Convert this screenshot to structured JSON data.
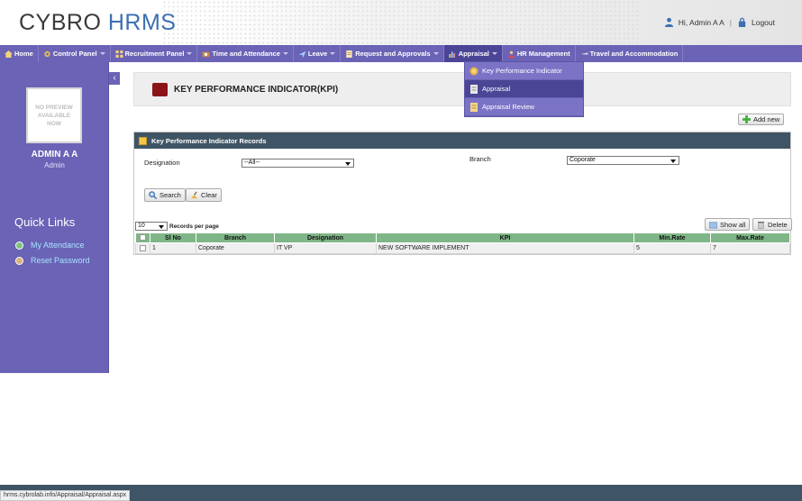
{
  "brand": {
    "part1": "CYBRO",
    "part2": "HRMS"
  },
  "user": {
    "greeting": "Hi, Admin A A",
    "logout": "Logout",
    "name": "ADMIN A A",
    "role": "Admin"
  },
  "avatar": {
    "text": "NO PREVIEW AVAILABLE NOW"
  },
  "nav": [
    {
      "label": "Home",
      "icon": "home-icon",
      "caret": false
    },
    {
      "label": "Control Panel",
      "icon": "gear-icon",
      "caret": true
    },
    {
      "label": "Recruitment Panel",
      "icon": "grid-icon",
      "caret": true
    },
    {
      "label": "Time and Attendance",
      "icon": "clock-icon",
      "caret": true
    },
    {
      "label": "Leave",
      "icon": "plane-icon",
      "caret": true
    },
    {
      "label": "Request and Approvals",
      "icon": "document-icon",
      "caret": true
    },
    {
      "label": "Appraisal",
      "icon": "bar-chart-icon",
      "caret": true,
      "active": true
    },
    {
      "label": "HR Management",
      "icon": "people-icon",
      "caret": false
    },
    {
      "label": "Travel and Accommodation",
      "icon": "airplane-icon",
      "caret": false
    }
  ],
  "dropdown": [
    {
      "label": "Key Performance Indicator",
      "icon": "medal-icon"
    },
    {
      "label": "Appraisal",
      "icon": "clipboard-icon",
      "selected": true
    },
    {
      "label": "Appraisal Review",
      "icon": "notes-icon"
    }
  ],
  "quick_links": {
    "title": "Quick Links",
    "items": [
      {
        "label": "My Attendance",
        "color": "#7fc37f"
      },
      {
        "label": "Reset Password",
        "color": "#d8b07f"
      }
    ]
  },
  "page": {
    "title": "KEY PERFORMANCE INDICATOR(KPI)",
    "add_new": "Add new"
  },
  "panel": {
    "title": "Key Performance Indicator Records",
    "designation_label": "Designation",
    "designation_value": "--All--",
    "branch_label": "Branch",
    "branch_value": "Coporate",
    "search_label": "Search",
    "clear_label": "Clear",
    "page_size": "10",
    "records_per_page": "Records per page",
    "show_all": "Show all",
    "delete": "Delete"
  },
  "table": {
    "columns": [
      "Sl No",
      "Branch",
      "Designation",
      "KPI",
      "Min.Rate",
      "Max.Rate"
    ],
    "rows": [
      [
        "1",
        "Coporate",
        "IT VP",
        "NEW SOFTWARE IMPLEMENT",
        "5",
        "7"
      ]
    ]
  },
  "status_url": "hrms.cybrolab.info/Appraisal/Appraisal.aspx",
  "colors": {
    "nav": "#6b63b6",
    "nav_active": "#4b4596",
    "panel_head": "#3f5565",
    "table_head": "#7fb687",
    "brand_blue": "#3d6fb0"
  }
}
